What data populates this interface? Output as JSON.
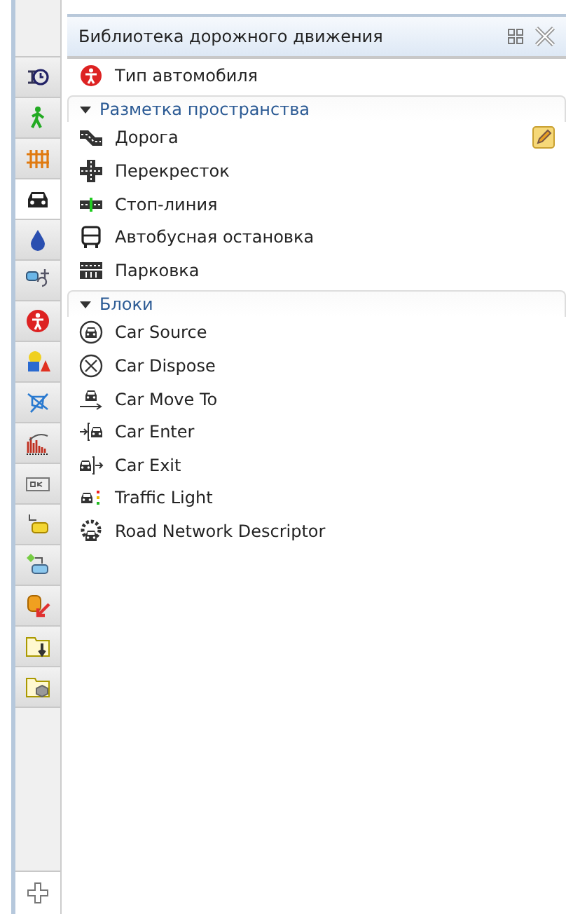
{
  "sidebar": {
    "tabs": [
      {
        "selected": false
      },
      {
        "selected": false
      },
      {
        "selected": false
      },
      {
        "selected": true
      },
      {
        "selected": false
      },
      {
        "selected": false
      },
      {
        "selected": false
      },
      {
        "selected": false
      },
      {
        "selected": false
      },
      {
        "selected": false
      },
      {
        "selected": false
      },
      {
        "selected": false
      },
      {
        "selected": false
      },
      {
        "selected": false
      },
      {
        "selected": false
      },
      {
        "selected": false
      }
    ]
  },
  "panel": {
    "title": "Библиотека дорожного движения"
  },
  "top_items": [
    {
      "label": "Тип автомобиля"
    }
  ],
  "sections": [
    {
      "title": "Разметка пространства",
      "expanded": true,
      "items": [
        {
          "label": "Дорога",
          "editable": true
        },
        {
          "label": "Перекресток",
          "editable": false
        },
        {
          "label": "Стоп-линия",
          "editable": false
        },
        {
          "label": "Автобусная остановка",
          "editable": false
        },
        {
          "label": "Парковка",
          "editable": false
        }
      ]
    },
    {
      "title": "Блоки",
      "expanded": true,
      "items": [
        {
          "label": "Car Source",
          "editable": false
        },
        {
          "label": "Car Dispose",
          "editable": false
        },
        {
          "label": "Car Move To",
          "editable": false
        },
        {
          "label": "Car Enter",
          "editable": false
        },
        {
          "label": "Car Exit",
          "editable": false
        },
        {
          "label": "Traffic Light",
          "editable": false
        },
        {
          "label": "Road Network Descriptor",
          "editable": false
        }
      ]
    }
  ]
}
